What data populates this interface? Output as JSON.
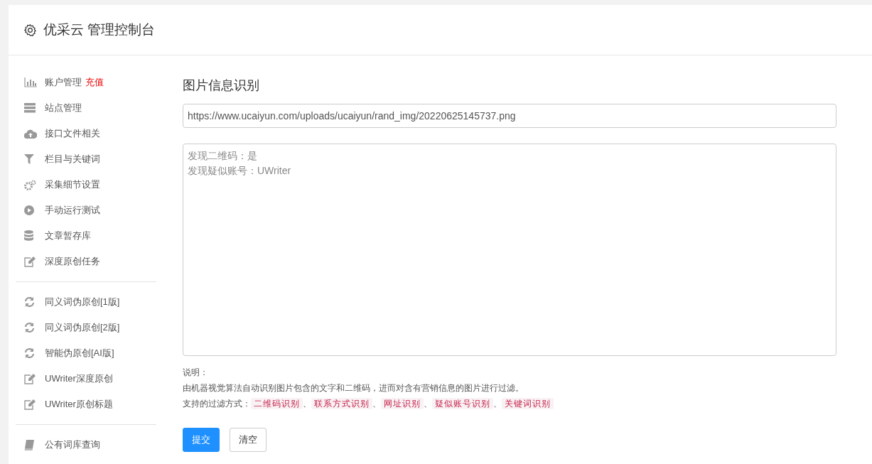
{
  "header": {
    "title": "优采云 管理控制台"
  },
  "sidebar": {
    "groups": [
      [
        {
          "label": "账户管理",
          "badge": "充值"
        },
        {
          "label": "站点管理"
        },
        {
          "label": "接口文件相关"
        },
        {
          "label": "栏目与关键词"
        },
        {
          "label": "采集细节设置"
        },
        {
          "label": "手动运行测试"
        },
        {
          "label": "文章暂存库"
        },
        {
          "label": "深度原创任务"
        }
      ],
      [
        {
          "label": "同义词伪原创[1版]"
        },
        {
          "label": "同义词伪原创[2版]"
        },
        {
          "label": "智能伪原创[AI版]"
        },
        {
          "label": "UWriter深度原创"
        },
        {
          "label": "UWriter原创标题"
        }
      ],
      [
        {
          "label": "公有词库查询"
        }
      ]
    ]
  },
  "main": {
    "title": "图片信息识别",
    "url_field": {
      "value": "https://www.ucaiyun.com/uploads/ucaiyun/rand_img/20220625145737.png"
    },
    "result": {
      "lines": [
        "发现二维码：是",
        "发现疑似账号：UWriter"
      ]
    },
    "note": {
      "heading": "说明：",
      "description": "由机器视觉算法自动识别图片包含的文字和二维码，进而对含有营销信息的图片进行过滤。",
      "methods_label": "支持的过滤方式：",
      "separator": "、",
      "methods": [
        "二维码识别",
        "联系方式识别",
        "网址识别",
        "疑似账号识别",
        "关键词识别"
      ]
    },
    "buttons": [
      {
        "label": "提交",
        "kind": "primary"
      },
      {
        "label": "清空",
        "kind": "default"
      }
    ]
  }
}
